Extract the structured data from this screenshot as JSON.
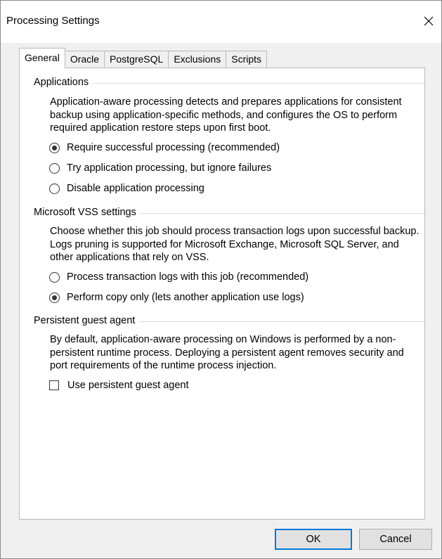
{
  "window": {
    "title": "Processing Settings"
  },
  "tabs": [
    {
      "label": "General",
      "active": true
    },
    {
      "label": "Oracle",
      "active": false
    },
    {
      "label": "PostgreSQL",
      "active": false
    },
    {
      "label": "Exclusions",
      "active": false
    },
    {
      "label": "Scripts",
      "active": false
    }
  ],
  "applications": {
    "header": "Applications",
    "description": "Application-aware processing detects and prepares applications for consistent backup using application-specific methods, and configures the OS to perform required application restore steps upon first boot.",
    "options": [
      {
        "label": "Require successful processing (recommended)",
        "selected": true
      },
      {
        "label": "Try application processing, but ignore failures",
        "selected": false
      },
      {
        "label": "Disable application processing",
        "selected": false
      }
    ]
  },
  "vss": {
    "header": "Microsoft VSS settings",
    "description": "Choose whether this job should process transaction logs upon successful backup. Logs pruning is supported for Microsoft Exchange, Microsoft SQL Server, and other applications that rely on VSS.",
    "options": [
      {
        "label": "Process transaction logs with this job (recommended)",
        "selected": false
      },
      {
        "label": "Perform copy only (lets another application use logs)",
        "selected": true
      }
    ]
  },
  "guest_agent": {
    "header": "Persistent guest agent",
    "description": "By default, application-aware processing on Windows is performed by a non-persistent runtime process. Deploying a persistent agent removes security and port requirements of the runtime process injection.",
    "checkbox_label": "Use persistent guest agent",
    "checked": false
  },
  "buttons": {
    "ok": "OK",
    "cancel": "Cancel"
  },
  "colors": {
    "accent": "#0078d7",
    "window_bg": "#f0f0f0",
    "panel_bg": "#ffffff"
  },
  "icons": {
    "close": "close-icon"
  }
}
